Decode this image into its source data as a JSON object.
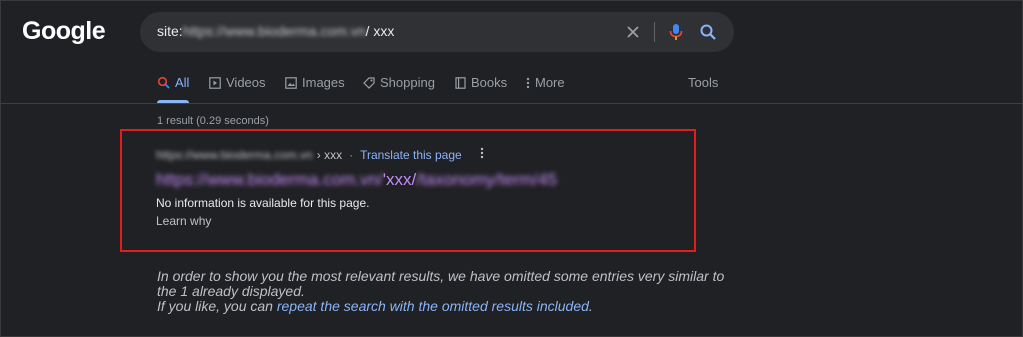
{
  "logo": "Google",
  "search": {
    "query_prefix": "site:",
    "query_blurred": "https://www.bioderma.com.vn",
    "query_suffix": "/ xxx"
  },
  "tabs": [
    {
      "label": "All"
    },
    {
      "label": "Videos"
    },
    {
      "label": "Images"
    },
    {
      "label": "Shopping"
    },
    {
      "label": "Books"
    },
    {
      "label": "More"
    }
  ],
  "tools_label": "Tools",
  "stats": "1 result (0.29 seconds)",
  "result": {
    "cite_url_blurred": "https://www.bioderma.com.vn",
    "cite_crumb": "› xxx",
    "dot": "·",
    "translate": "Translate this page",
    "title_blurred_start": "https://www.bioderma.com.vn/",
    "title_clear": "'xxx/",
    "title_blurred_end": "/taxonomy/term/45",
    "snippet": "No information is available for this page.",
    "learn_why": "Learn why"
  },
  "omitted": {
    "line1": "In order to show you the most relevant results, we have omitted some entries very similar to",
    "line2": "the 1 already displayed.",
    "line3_prefix": "If you like, you can ",
    "line3_link": "repeat the search with the omitted results included",
    "line3_suffix": "."
  },
  "colors": {
    "background": "#202124",
    "link": "#8ab4f8",
    "visited": "#c58af9",
    "highlight": "#e51c1c"
  }
}
